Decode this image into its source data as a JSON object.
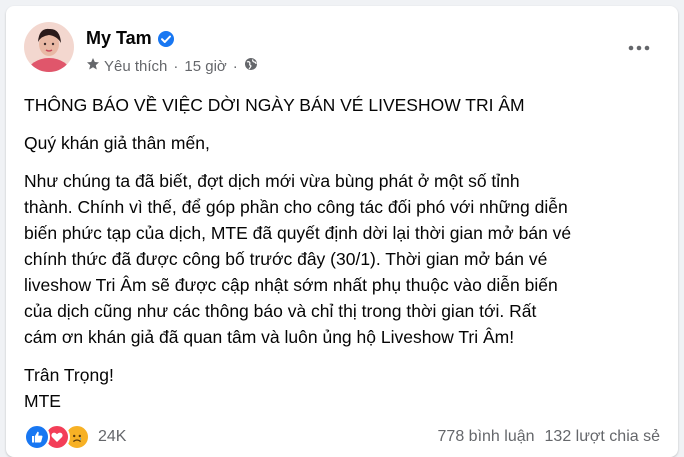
{
  "post": {
    "author": "My Tam",
    "audience_label": "Yêu thích",
    "time": "15 giờ",
    "dot": "·",
    "verified_icon": "verified-badge-icon",
    "privacy_icon": "globe-icon",
    "more_icon": "more-horizontal-icon",
    "title": "THÔNG BÁO VỀ VIỆC DỜI NGÀY BÁN VÉ LIVESHOW TRI ÂM",
    "greeting": "Quý khán giả thân mến,",
    "body_lines": [
      "Như chúng ta đã biết, đợt dịch mới vừa bùng phát ở một số tỉnh",
      "thành. Chính vì thế, để góp phần cho công tác đối phó với những diễn",
      "biến phức tạp của dịch, MTE đã quyết định dời lại thời gian mở bán vé",
      "chính thức đã được công bố trước đây (30/1). Thời gian mở bán vé",
      "liveshow Tri Âm sẽ được cập nhật sớm nhất phụ thuộc vào diễn biến",
      "của dịch cũng như các thông báo và chỉ thị trong thời gian tới. Rất",
      "cám ơn khán giả đã quan tâm và luôn ủng hộ Liveshow Tri Âm!"
    ],
    "signoff_1": "Trân Trọng!",
    "signoff_2": "MTE"
  },
  "footer": {
    "reactions": [
      "like-reaction-icon",
      "love-reaction-icon",
      "sad-reaction-icon"
    ],
    "reaction_count": "24K",
    "comments": "778 bình luận",
    "shares": "132 lượt chia sẻ"
  },
  "colors": {
    "facebook_blue": "#1877f2",
    "love_red": "#f33e58",
    "sad_yellow": "#f7b125",
    "secondary_text": "#65676b"
  }
}
